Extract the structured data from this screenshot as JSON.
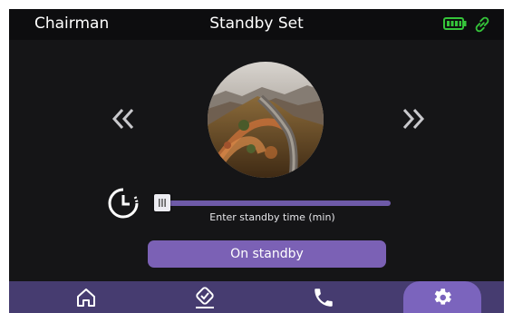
{
  "header": {
    "user": "Chairman",
    "title": "Standby Set",
    "battery_icon": "battery-icon",
    "link_icon": "link-icon",
    "status_color": "#35c43a"
  },
  "carousel": {
    "prev_icon": "double-chevron-left-icon",
    "next_icon": "double-chevron-right-icon",
    "image": "great-wall-photo"
  },
  "standby": {
    "slider_label": "Enter standby time (min)",
    "slider_value_fraction": 0.0,
    "button_label": "On standby"
  },
  "nav": {
    "items": [
      "home-icon",
      "check-icon",
      "phone-icon",
      "settings-icon"
    ],
    "active": "settings-icon"
  },
  "colors": {
    "accent": "#7b61b5",
    "bar": "#463c70",
    "background": "#151517"
  }
}
